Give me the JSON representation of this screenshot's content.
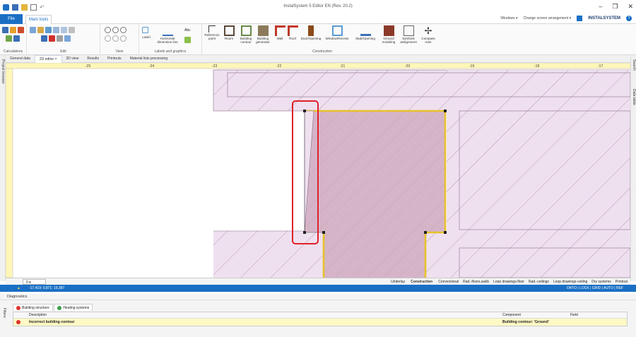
{
  "app": {
    "title": "InstalSystem 5 Editor EN (Rev. 20.2)",
    "brand": "INSTALSYSTEM",
    "windows_menu": "Windows ▾",
    "arrangement_menu": "Change screen arrangement ▾"
  },
  "ribbon_tabs": {
    "file": "File",
    "main": "Main tools"
  },
  "ribbon_groups": {
    "calculations": "Calculations",
    "edit": "Edit",
    "view": "View",
    "labels": "Labels and graphics",
    "construction": "Construction"
  },
  "labels_buttons": {
    "label": "Label",
    "hdim": "Horizontal dimension line",
    "abc": "Abc"
  },
  "construction_buttons": [
    "Reference point",
    "Room",
    "Building contour",
    "Building generator",
    "Wall",
    "Roof",
    "Door/Opening",
    "Window/Recess",
    "Slab/Opening",
    "Ground modeling",
    "Symbols assignment",
    "Compass rose"
  ],
  "doc_tabs": [
    "General data",
    "2D editor",
    "3D view",
    "Results",
    "Printouts",
    "Material lists processing"
  ],
  "side_panels": {
    "left": "Project browser",
    "right_top": "Search",
    "right_bottom": "Data table"
  },
  "ruler": {
    "labels": [
      "-25",
      "-24",
      "-23",
      "-22",
      "-21",
      "-20",
      "-19",
      "-18",
      "-17"
    ]
  },
  "bottom_bar": {
    "layer": "0",
    "layers": [
      "Underlay",
      "Construction",
      "Convectional",
      "Rad.-floors,walls",
      "Loop drawings-floor",
      "Rad.-ceilings",
      "Loop drawings-ceiling",
      "Dry systems",
      "Printout"
    ]
  },
  "status": {
    "coords": "-17,419; 0,871; 19,387",
    "modes": "ORTO | LOCK | GRID | AUTO | REF"
  },
  "diagnostics": {
    "title": "Diagnostics",
    "filters": "Filters",
    "tabs": [
      "Building structure",
      "Heating systems"
    ],
    "columns": {
      "description": "Description",
      "component": "Component",
      "field": "Field"
    },
    "rows": [
      {
        "description": "Incorrect building contour",
        "component": "Building contour: 'Ground'",
        "field": ""
      }
    ]
  },
  "colors": {
    "accent": "#1a6fc4",
    "room_fill": "#d6b4c8",
    "area_fill": "#efe0ef",
    "highlight_border": "#e8c12a",
    "selection_box": "#e0202a"
  }
}
